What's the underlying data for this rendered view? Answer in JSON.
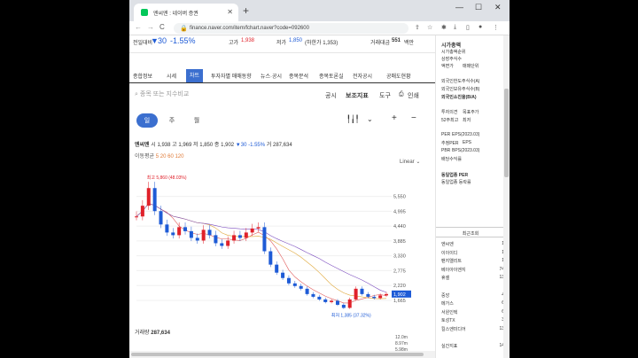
{
  "browser": {
    "tab_title": "엔씨엔 : 네이버 증권",
    "tab_close": "✕",
    "new_tab": "+",
    "url": "finance.naver.com/item/fchart.naver?code=092600",
    "back": "←",
    "forward": "→",
    "reload": "C",
    "win_min": "—",
    "win_max": "☐",
    "win_close": "✕"
  },
  "summary": {
    "prev_label": "전일대비",
    "prev_arrow": "▼",
    "prev_change": "30",
    "prev_pct": "-1.55%",
    "high_label": "고가",
    "high_value": "1,938",
    "low_label": "저가",
    "low_value": "1,850",
    "low_limit": "(하한가 1,353)",
    "amount_label": "거래대금",
    "amount_value": "551",
    "amount_unit": "백만"
  },
  "tabs": [
    "종합정보",
    "시세",
    "차트",
    "투자자별 매매동향",
    "뉴스·공시",
    "종목분석",
    "종목토론실",
    "전자공시",
    "공매도현황"
  ],
  "active_tab": "차트",
  "search": {
    "placeholder": "종목 또는 지수비교"
  },
  "tools": {
    "disclosure": "공시",
    "indicator": "보조지표",
    "tool": "도구",
    "print": "인쇄"
  },
  "periods": [
    "일",
    "주",
    "월"
  ],
  "info": {
    "name": "엔씨엔",
    "start_label": "시",
    "start": "1,938",
    "high_label": "고",
    "high": "1,969",
    "low_label": "저",
    "low": "1,850",
    "end_label": "종",
    "end": "1,902",
    "change": "▼30",
    "pct": "-1.55%",
    "vol_label": "거",
    "vol": "287,634"
  },
  "ma": {
    "label": "이동평균",
    "values": "5 20 60 120"
  },
  "scale": "Linear",
  "chart_data": {
    "type": "line",
    "y_ticks": [
      "5,550",
      "4,995",
      "4,440",
      "3,885",
      "3,330",
      "2,775",
      "2,220",
      "1,665"
    ],
    "current": "1,902",
    "max_label": "최고 5,860 (48.03%)",
    "min_label": "최저 1,385 (37.32%)",
    "volume_label": "거래량",
    "volume_value": "287,634",
    "vol_ticks": [
      "12.0m",
      "8.97m",
      "5.98m"
    ],
    "values": [
      4800,
      5200,
      5860,
      5000,
      4500,
      4200,
      4100,
      4400,
      4250,
      4000,
      3900,
      4300,
      4100,
      3800,
      3700,
      3900,
      4100,
      4000,
      4200,
      4350,
      4400,
      3500,
      3000,
      2700,
      2500,
      2300,
      2200,
      2100,
      1900,
      1800,
      1700,
      1600,
      1650,
      1500,
      1385,
      1700,
      2100,
      1900,
      1800,
      1750,
      1850,
      1902
    ]
  },
  "sidebar": {
    "market_cap": "시가총액",
    "cap_rank": "시가총액순위",
    "listed_shares": "상장주식수",
    "face_value": "액면가",
    "trade_unit": "매매단위",
    "foreign_limit": "외국인한도주식수(A)",
    "foreign_hold": "외국인보유주식수(B)",
    "foreign_rate": "외국인소진율(B/A)",
    "opinion": "투자의견",
    "target": "목표주가",
    "high52": "52주최고",
    "low52": "최저",
    "per": "PER",
    "eps": "EPS(2023.03)",
    "est_per": "추정PER",
    "est_eps": "EPS",
    "pbr": "PBR",
    "bps": "BPS(2023.03)",
    "dividend": "배당수익률",
    "same_per": "동일업종 PER",
    "same_rate": "동일업종 등락률",
    "recent": "최근조회",
    "recent_items": [
      {
        "name": "엔씨엔",
        "v": "1"
      },
      {
        "name": "이이이디",
        "v": "1"
      },
      {
        "name": "팬지엘리트",
        "v": "1"
      },
      {
        "name": "베이아이엔지",
        "v": "74"
      },
      {
        "name": "휴셀",
        "v": "13"
      },
      {
        "name": "",
        "v": ""
      },
      {
        "name": "중앙",
        "v": "4"
      },
      {
        "name": "메가스",
        "v": "6"
      },
      {
        "name": "서원인텍",
        "v": "6"
      },
      {
        "name": "토성TX",
        "v": "3"
      },
      {
        "name": "킬스엔미디어",
        "v": "13"
      },
      {
        "name": "",
        "v": ""
      },
      {
        "name": "실간지표",
        "v": "14"
      }
    ]
  }
}
